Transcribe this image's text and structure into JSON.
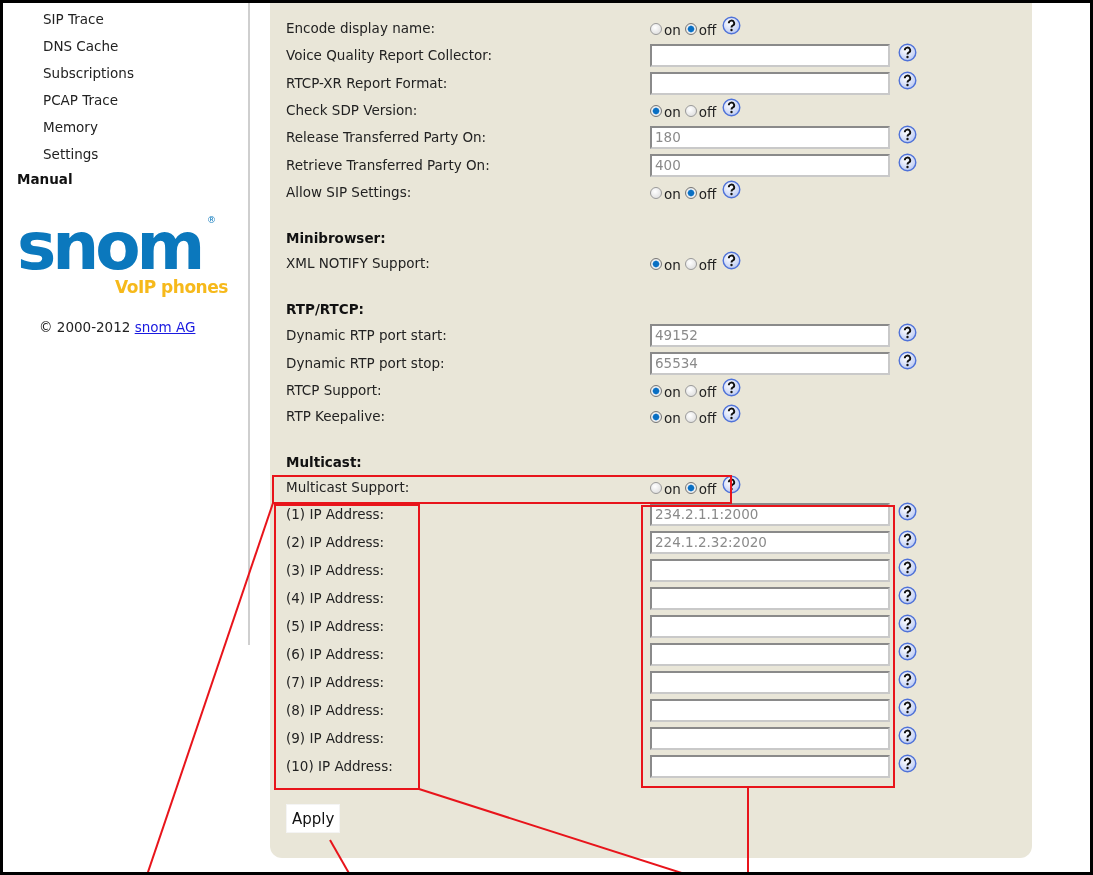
{
  "sidebar": {
    "items": [
      {
        "label": "SIP Trace",
        "kind": "link"
      },
      {
        "label": "DNS Cache",
        "kind": "link"
      },
      {
        "label": "Subscriptions",
        "kind": "link"
      },
      {
        "label": "PCAP Trace",
        "kind": "link"
      },
      {
        "label": "Memory",
        "kind": "link"
      },
      {
        "label": "Settings",
        "kind": "link"
      },
      {
        "label": "Manual",
        "kind": "heading"
      }
    ],
    "logo": {
      "name": "snom",
      "mark": "®",
      "tagline": "VoIP phones"
    },
    "copyright": {
      "text": "© 2000-2012",
      "link": "snom AG"
    }
  },
  "settings": {
    "sections": [
      {
        "rows": [
          {
            "label": "Encode display name:",
            "kind": "radio",
            "options": [
              {
                "label": "on",
                "selected": false
              },
              {
                "label": "off",
                "selected": true
              }
            ]
          },
          {
            "label": "Voice Quality Report Collector:",
            "kind": "text"
          },
          {
            "label": "RTCP-XR Report Format:",
            "kind": "text"
          },
          {
            "label": "Check SDP Version:",
            "kind": "radio",
            "options": [
              {
                "label": "on",
                "selected": true
              },
              {
                "label": "off",
                "selected": false
              }
            ]
          },
          {
            "label": "Release Transferred Party On:",
            "kind": "text",
            "value": "180"
          },
          {
            "label": "Retrieve Transferred Party On:",
            "kind": "text",
            "value": "400"
          },
          {
            "label": "Allow SIP Settings:",
            "kind": "radio",
            "options": [
              {
                "label": "on",
                "selected": false
              },
              {
                "label": "off",
                "selected": true
              }
            ]
          }
        ]
      },
      {
        "heading": "Minibrowser:",
        "rows": [
          {
            "label": "XML NOTIFY Support:",
            "kind": "radio",
            "options": [
              {
                "label": "on",
                "selected": true
              },
              {
                "label": "off",
                "selected": false
              }
            ]
          }
        ]
      },
      {
        "heading": "RTP/RTCP:",
        "rows": [
          {
            "label": "Dynamic RTP port start:",
            "kind": "text",
            "value": "49152"
          },
          {
            "label": "Dynamic RTP port stop:",
            "kind": "text",
            "value": "65534"
          },
          {
            "label": "RTCP Support:",
            "kind": "radio",
            "options": [
              {
                "label": "on",
                "selected": true
              },
              {
                "label": "off",
                "selected": false
              }
            ]
          },
          {
            "label": "RTP Keepalive:",
            "kind": "radio",
            "options": [
              {
                "label": "on",
                "selected": true
              },
              {
                "label": "off",
                "selected": false
              }
            ]
          }
        ]
      },
      {
        "heading": "Multicast:",
        "rows": [
          {
            "label": "Multicast Support:",
            "kind": "radio",
            "options": [
              {
                "label": "on",
                "selected": false
              },
              {
                "label": "off",
                "selected": true
              }
            ]
          },
          {
            "label": "(1) IP Address:",
            "kind": "text",
            "value": "234.2.1.1:2000"
          },
          {
            "label": "(2) IP Address:",
            "kind": "text",
            "value": "224.1.2.32:2020"
          },
          {
            "label": "(3) IP Address:",
            "kind": "text"
          },
          {
            "label": "(4) IP Address:",
            "kind": "text"
          },
          {
            "label": "(5) IP Address:",
            "kind": "text"
          },
          {
            "label": "(6) IP Address:",
            "kind": "text"
          },
          {
            "label": "(7) IP Address:",
            "kind": "text"
          },
          {
            "label": "(8) IP Address:",
            "kind": "text"
          },
          {
            "label": "(9) IP Address:",
            "kind": "text"
          },
          {
            "label": "(10) IP Address:",
            "kind": "text"
          }
        ]
      }
    ],
    "apply_button": "Apply"
  }
}
